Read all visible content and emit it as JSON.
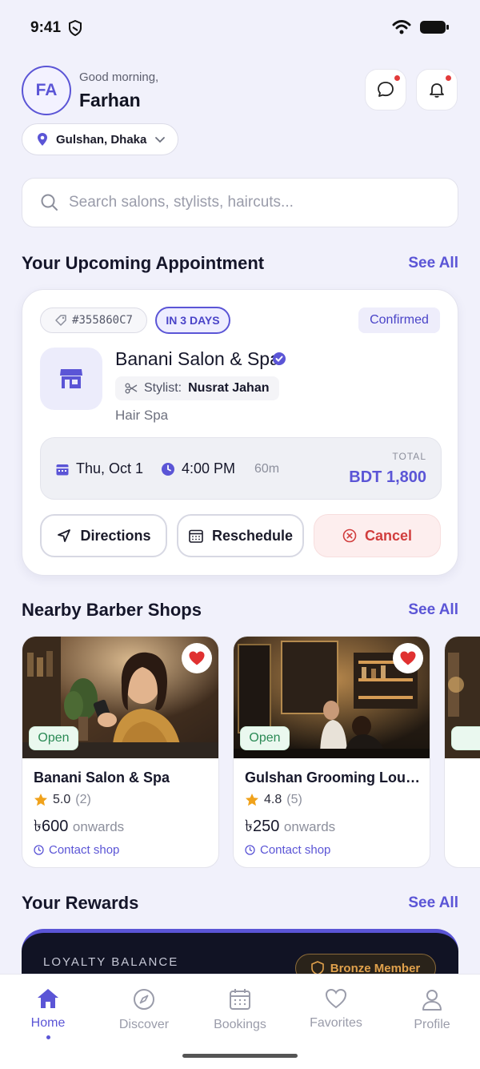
{
  "status_bar": {
    "time": "9:41"
  },
  "header": {
    "avatar_initials": "FA",
    "greeting": "Good morning,",
    "user_name": "Farhan",
    "location": "Gulshan, Dhaka"
  },
  "search": {
    "placeholder": "Search salons, stylists, haircuts..."
  },
  "upcoming": {
    "title": "Your Upcoming Appointment",
    "see_all": "See All",
    "booking_id": "#355860C7",
    "countdown": "IN 3 DAYS",
    "status": "Confirmed",
    "salon_name": "Banani Salon & Spa",
    "stylist_label": "Stylist:",
    "stylist_name": "Nusrat Jahan",
    "service": "Hair Spa",
    "date": "Thu, Oct 1",
    "time": "4:00 PM",
    "duration": "60m",
    "total_label": "TOTAL",
    "total": "BDT 1,800",
    "directions_label": "Directions",
    "reschedule_label": "Reschedule",
    "cancel_label": "Cancel"
  },
  "nearby": {
    "title": "Nearby Barber Shops",
    "see_all": "See All",
    "shops": [
      {
        "name": "Banani Salon & Spa",
        "status": "Open",
        "rating": "5.0",
        "reviews": "(2)",
        "price": "৳600",
        "price_suffix": "onwards",
        "contact": "Contact shop"
      },
      {
        "name": "Gulshan Grooming Loun...",
        "status": "Open",
        "rating": "4.8",
        "reviews": "(5)",
        "price": "৳250",
        "price_suffix": "onwards",
        "contact": "Contact shop"
      }
    ]
  },
  "rewards": {
    "title": "Your Rewards",
    "see_all": "See All",
    "loyalty_label": "LOYALTY BALANCE",
    "tier": "Bronze Member"
  },
  "bottom_nav": {
    "items": [
      "Home",
      "Discover",
      "Bookings",
      "Favorites",
      "Profile"
    ]
  },
  "colors": {
    "accent": "#5b55d6",
    "danger": "#d13d3d",
    "open": "#2a8a55",
    "star": "#f0a21b",
    "tier": "#e0a14c"
  }
}
